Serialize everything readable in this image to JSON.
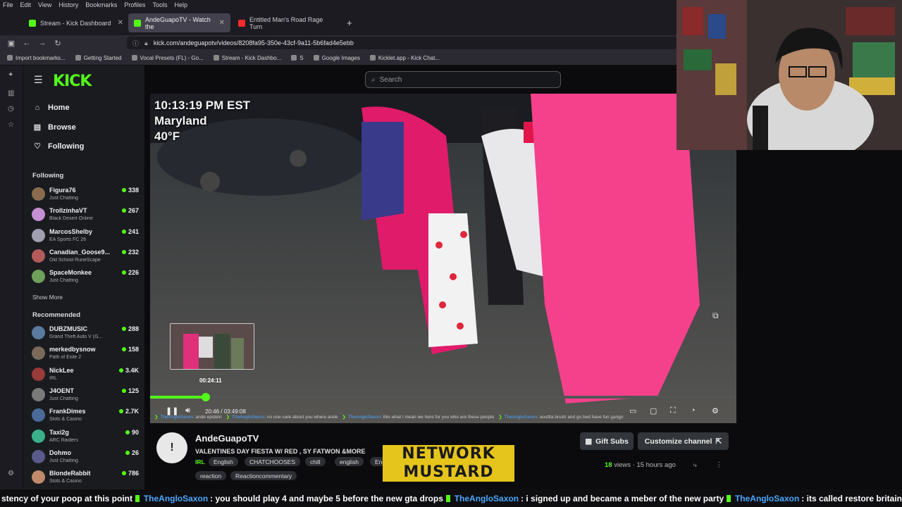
{
  "browser": {
    "menu": [
      "File",
      "Edit",
      "View",
      "History",
      "Bookmarks",
      "Profiles",
      "Tools",
      "Help"
    ],
    "tabs": [
      {
        "label": "Stream - Kick Dashboard",
        "color": "#53fc18"
      },
      {
        "label": "AndeGuapoTV - Watch the",
        "color": "#53fc18"
      },
      {
        "label": "Entitled Man's Road Rage Turn",
        "color": "#ff2b2b"
      }
    ],
    "new_tab": "+",
    "url": "kick.com/andeguapotv/videos/8208fa95-350e-43cf-9a11-5b6fad4e5ebb",
    "bookmarks": [
      "Import bookmarks...",
      "Getting Started",
      "Vocal Presets (FL) - Go...",
      "Stream - Kick Dashbo...",
      "S",
      "Google Images",
      "Kicklet.app - Kick Chat..."
    ]
  },
  "kick": {
    "logo": "KICK",
    "search_placeholder": "Search",
    "nav": [
      {
        "label": "Home",
        "icon": "home-icon",
        "glyph": "⌂"
      },
      {
        "label": "Browse",
        "icon": "browse-icon",
        "glyph": "▤"
      },
      {
        "label": "Following",
        "icon": "heart-icon",
        "glyph": "♡"
      }
    ],
    "following_title": "Following",
    "following": [
      {
        "name": "Figura76",
        "category": "Just Chatting",
        "viewers": "338",
        "color": "#8a6b4e"
      },
      {
        "name": "TrollzinhaVT",
        "category": "Black Desert Online",
        "viewers": "267",
        "color": "#c58fd3"
      },
      {
        "name": "MarcosShelby",
        "category": "EA Sports FC 26",
        "viewers": "241",
        "color": "#a0a0b0"
      },
      {
        "name": "Canadian_Goose9...",
        "category": "Old School RuneScape",
        "viewers": "232",
        "color": "#b55a5a"
      },
      {
        "name": "SpaceMonkee",
        "category": "Just Chatting",
        "viewers": "226",
        "color": "#6fa05a"
      }
    ],
    "show_more": "Show More",
    "recommended_title": "Recommended",
    "recommended": [
      {
        "name": "DUBZMUSIC",
        "category": "Grand Theft Auto V (G...",
        "viewers": "288",
        "color": "#5a7aa0"
      },
      {
        "name": "merkedbysnow",
        "category": "Path of Exile 2",
        "viewers": "158",
        "color": "#7a6a5a"
      },
      {
        "name": "NickLee",
        "category": "IRL",
        "viewers": "3.4K",
        "color": "#9a3a3a"
      },
      {
        "name": "J4OENT",
        "category": "Just Chatting",
        "viewers": "125",
        "color": "#7a7a7a"
      },
      {
        "name": "FrankDimes",
        "category": "Slots & Casino",
        "viewers": "2.7K",
        "color": "#4a6a9a"
      },
      {
        "name": "Taxi2g",
        "category": "ARC Raiders",
        "viewers": "90",
        "color": "#3ab08a"
      },
      {
        "name": "Dohmo",
        "category": "Just Chatting",
        "viewers": "26",
        "color": "#5a5a8a"
      },
      {
        "name": "BlondeRabbit",
        "category": "Slots & Casino",
        "viewers": "786",
        "color": "#c08a6a"
      }
    ]
  },
  "video": {
    "overlay": [
      "10:13:19 PM EST",
      "Maryland",
      "40°F"
    ],
    "preview_time": "00:24:11",
    "progress": 0.095,
    "timecode": "20:46 / 03:49:08",
    "chat_strip": [
      {
        "user": "TheAngloSaxon",
        "msg": ": ande epstein"
      },
      {
        "user": "TheAngloSaxon",
        "msg": ": no one care about you where ande"
      },
      {
        "user": "TheAngloSaxon",
        "msg": ": this what i mean we here for you who are these people"
      },
      {
        "user": "TheAngloSaxon",
        "msg": ": oouttta brush and go bed have fun gango"
      }
    ]
  },
  "info": {
    "channel_name": "AndeGuapoTV",
    "title": "VALENTINES DAY FIESTA W/ RED , SY FATWON &MORE",
    "category": "IRL",
    "tags": [
      "English",
      "CHATCHOOSES",
      "chill",
      "english",
      "Englis"
    ],
    "tags_row2": [
      "reaction",
      "Reactioncommentary"
    ],
    "gift_subs": "Gift Subs",
    "customize": "Customize channel",
    "views_count": "18",
    "views_label": "views",
    "ago": "15 hours ago",
    "overlay_logo": [
      "NETWORK",
      "MUSTARD"
    ]
  },
  "ticker": [
    {
      "user": "",
      "msg": "stency of your poop at this point"
    },
    {
      "user": "TheAngloSaxon",
      "msg": ": you should play 4 and maybe 5 before the new gta drops"
    },
    {
      "user": "TheAngloSaxon",
      "msg": ": i signed up and became a meber of the new party"
    },
    {
      "user": "TheAngloSaxon",
      "msg": ": its called restore britain"
    }
  ]
}
